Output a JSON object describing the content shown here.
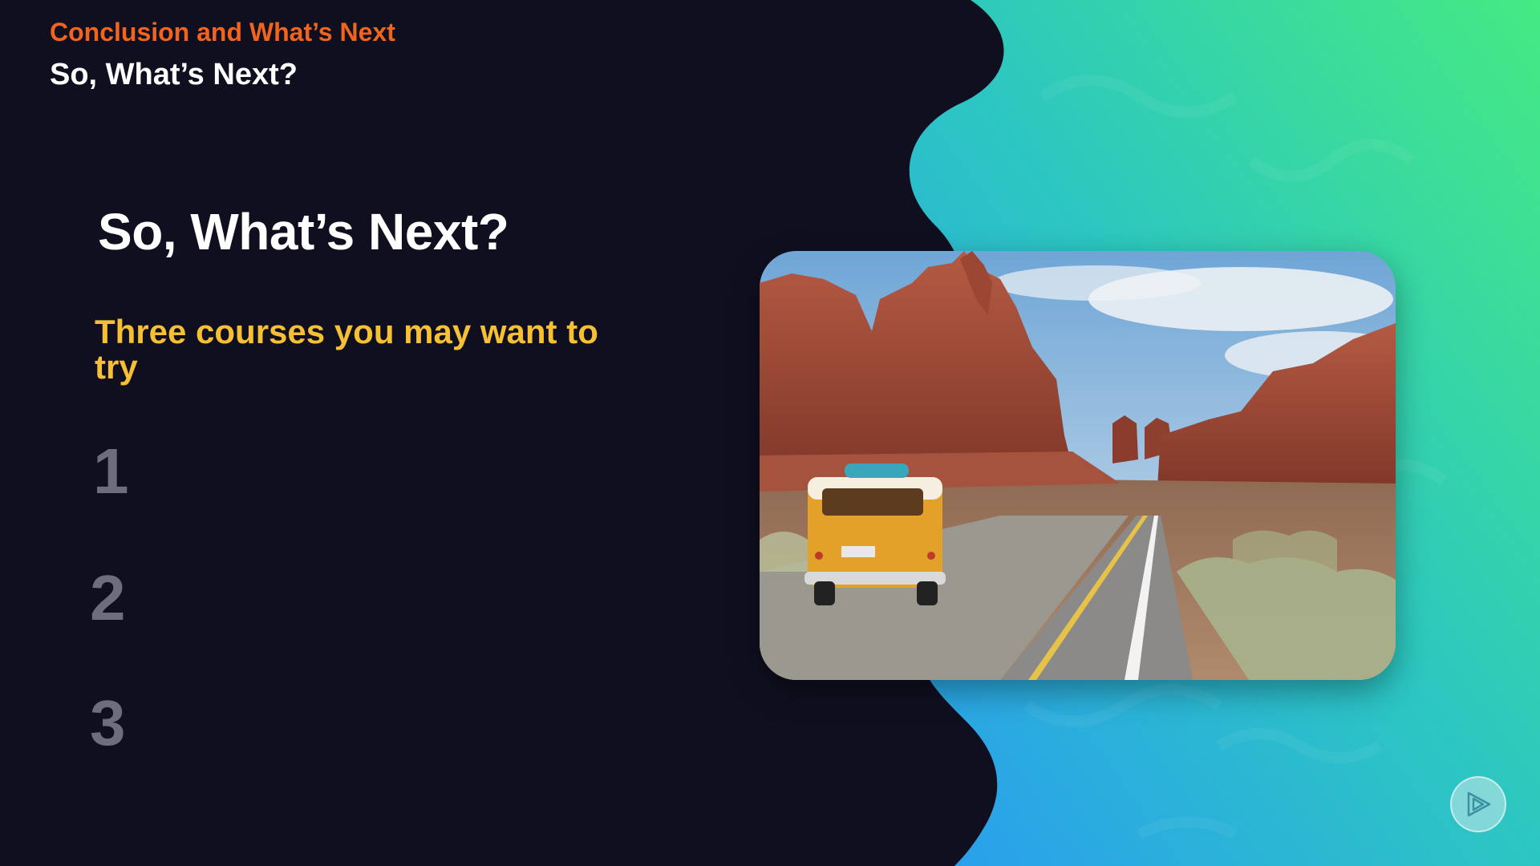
{
  "header": {
    "section_label": "Conclusion and What’s Next",
    "module_title": "So, What’s Next?"
  },
  "main": {
    "heading": "So, What’s Next?",
    "subheading": "Three courses you may want to try",
    "items": [
      {
        "number": "1"
      },
      {
        "number": "2"
      },
      {
        "number": "3"
      }
    ]
  },
  "image": {
    "subject": "yellow van on desert road with red rock formations"
  },
  "controls": {
    "play_icon": "play-icon"
  },
  "colors": {
    "background": "#0f0f1f",
    "accent_orange": "#f0641e",
    "accent_yellow": "#f5c034",
    "number_gray": "#6d6d7e",
    "gradient_green": "#3ee28e",
    "gradient_blue": "#27a6e6"
  }
}
